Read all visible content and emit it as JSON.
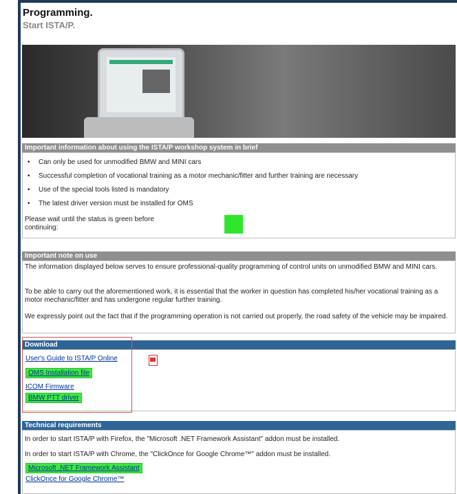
{
  "header": {
    "title": "Programming.",
    "subtitle": "Start ISTA/P."
  },
  "sections": {
    "brief": {
      "heading": "Important information about using the ISTA/P workshop system in brief",
      "items": [
        "Can only be used for unmodified BMW and MINI cars",
        "Successful completion of vocational training as a motor mechanic/fitter and further training are necessary",
        "Use of the special tools listed is mandatory",
        "The latest driver version must be installed for OMS"
      ],
      "status_text_line1": "Please wait until the status is green before",
      "status_text_line2": "continuing:",
      "status_color": "#2fe62f"
    },
    "note": {
      "heading": "Important note on use",
      "paragraphs": [
        "The information displayed below serves to ensure professional-quality programming of control units on unmodified BMW and MINI cars.",
        "To be able to carry out the aforementioned work, it is essential that the worker in question has completed his/her vocational training as a motor mechanic/fitter and has undergone regular further training.",
        "We expressly point out the fact that if the programming operation is not carried out properly, the road safety of the vehicle may be impaired."
      ]
    },
    "download": {
      "heading": "Download",
      "links": [
        "User's Guide to ISTA/P Online",
        "OMS Installation file",
        "ICOM Firmware",
        "BMW PTT driver"
      ]
    },
    "tech": {
      "heading": "Technical requirements",
      "paragraphs": [
        "In order to start ISTA/P with Firefox, the \"Microsoft .NET Framework Assistant\" addon must be installed.",
        "In order to start ISTA/P with Chrome, the \"ClickOnce for Google Chrome™\" addon must be installed."
      ],
      "links": [
        "Microsoft .NET Framework Assistant",
        "ClickOnce for Google Chrome™"
      ]
    }
  },
  "colors": {
    "frame": "#1f3a5a",
    "gray_header": "#8f8f8f",
    "blue_header": "#2f6596",
    "highlight": "#3fe83f",
    "red_outline": "#d9534f"
  }
}
